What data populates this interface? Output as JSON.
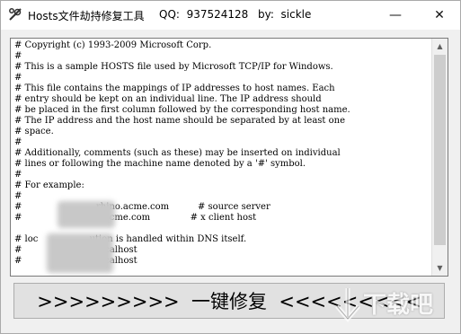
{
  "window": {
    "title": "Hosts文件劫持修复工具",
    "qq": "QQ:  937524128",
    "by": "by:  sickle",
    "minimize_glyph": "—",
    "close_glyph": "✕"
  },
  "editor": {
    "lines": [
      "# Copyright (c) 1993-2009 Microsoft Corp.",
      "#",
      "# This is a sample HOSTS file used by Microsoft TCP/IP for Windows.",
      "#",
      "# This file contains the mappings of IP addresses to host names. Each",
      "# entry should be kept on an individual line. The IP address should",
      "# be placed in the first column followed by the corresponding host name.",
      "# The IP address and the host name should be separated by at least one",
      "# space.",
      "#",
      "# Additionally, comments (such as these) may be inserted on individual",
      "# lines or following the machine name denoted by a '#' symbol.",
      "#",
      "# For example:",
      "#",
      "#                          rhino.acme.com          # source server",
      "#                          x.acme.com              # x client host",
      "",
      "# loc                  ution is handled within DNS itself.",
      "#                          localhost",
      "#                          localhost"
    ]
  },
  "scrollbar": {
    "up_glyph": "▲",
    "down_glyph": "▼"
  },
  "action": {
    "fix_label": ">>>>>>>>>  一键修复  <<<<<<<<<"
  },
  "watermark": {
    "text": "下载吧"
  },
  "icons": {
    "app": "wrench-icon",
    "minimize": "minimize-icon",
    "close": "close-icon"
  }
}
